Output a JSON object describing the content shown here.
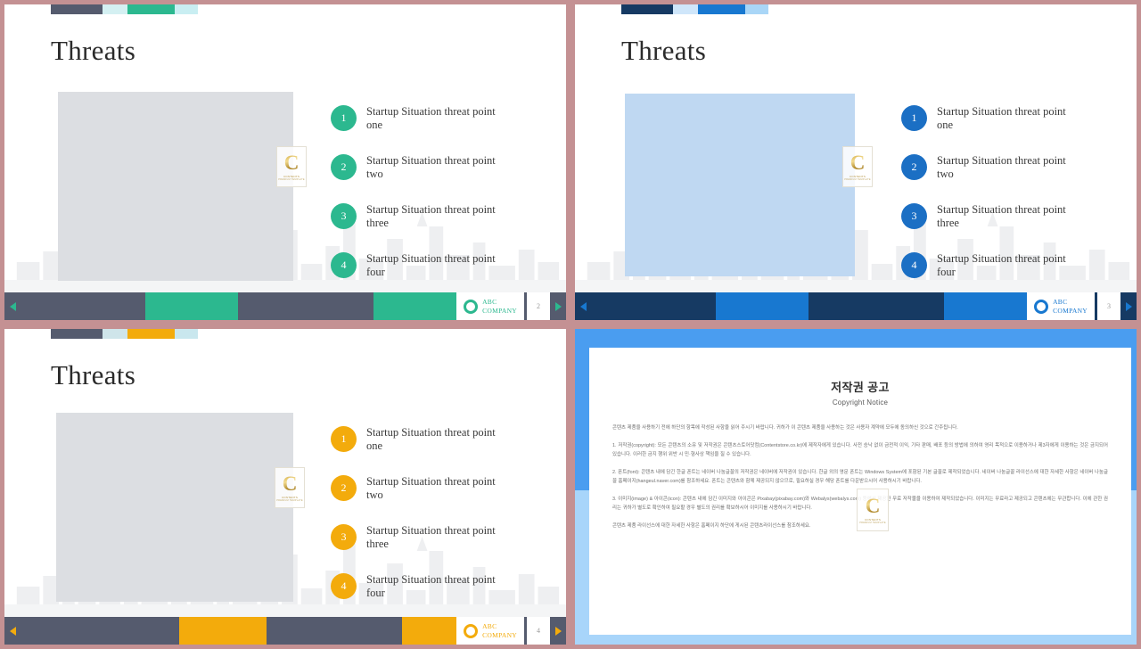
{
  "meta": {
    "outer_border_color": "#c49193",
    "gutter_color": "#c49193"
  },
  "shared": {
    "title": "Threats",
    "points": [
      {
        "num": "1",
        "text": "Startup Situation threat point one"
      },
      {
        "num": "2",
        "text": "Startup Situation threat point two"
      },
      {
        "num": "3",
        "text": "Startup Situation threat point three"
      },
      {
        "num": "4",
        "text": "Startup Situation threat point four"
      }
    ],
    "logo": {
      "line1": "ABC",
      "line2": "COMPANY",
      "ring_icon": "ring-icon",
      "watermark_letter": "C",
      "watermark_sub": "CONTENTS",
      "watermark_sub2": "PREMIUM TEMPLATE"
    },
    "nav": {
      "prev_icon": "triangle-left-icon",
      "next_icon": "triangle-right-icon"
    }
  },
  "slides": [
    {
      "id": "slide-threats-green",
      "theme": "green",
      "title": "Threats",
      "page_number": "2",
      "accent": "#2cb88f",
      "accent_light": "#d4f0f2",
      "dark": "#555b6e",
      "circle_color": "#2cb88f",
      "picture_fill": "#dcdee2",
      "topbar": [
        "#555b6e",
        "#d4f0f2",
        "#2cb88f",
        "#c9eef2"
      ],
      "footer_segments": [
        "#555b6e",
        "#2cb88f",
        "#555b6e",
        "#2cb88f"
      ],
      "logo_color": "#2cb88f",
      "arrow_color": "#2cb88f"
    },
    {
      "id": "slide-threats-blue",
      "theme": "blue",
      "title": "Threats",
      "page_number": "3",
      "accent": "#1878d0",
      "accent_light": "#c6def5",
      "dark": "#163a63",
      "circle_color": "#1b6fc4",
      "picture_fill": "#bfd8f2",
      "topbar": [
        "#163a63",
        "#cfe6fa",
        "#1878d0",
        "#a9d6f7"
      ],
      "footer_segments": [
        "#163a63",
        "#1878d0",
        "#163a63",
        "#1878d0"
      ],
      "logo_color": "#1878d0",
      "arrow_color": "#1878d0"
    },
    {
      "id": "slide-threats-amber",
      "theme": "amber",
      "title": "Threats",
      "page_number": "4",
      "accent": "#f3ab0c",
      "accent_light": "#d4e9ee",
      "dark": "#555b6e",
      "circle_color": "#f3ab0c",
      "picture_fill": "#dcdee2",
      "topbar": [
        "#555b6e",
        "#cfe5ea",
        "#f3ab0c",
        "#c9e7ee"
      ],
      "footer_segments": [
        "#555b6e",
        "#f3ab0c",
        "#555b6e",
        "#f3ab0c"
      ],
      "logo_color": "#f3ab0c",
      "arrow_color": "#f3ab0c"
    }
  ],
  "copyright_slide": {
    "id": "slide-copyright-notice",
    "frame_top_color": "#4a9df0",
    "frame_bottom_color": "#a8d5fa",
    "title_kr": "저작권 공고",
    "title_en": "Copyright Notice",
    "paragraphs": [
      "콘텐츠 제품을 사용하기 전에 하단의 항목에 작성된 사항을 읽어 주시기 바랍니다. 귀하가 이 콘텐츠 제품을 사용하는 것은 사용자 계약에 모두에 동의하신 것으로 간주됩니다.",
      "1. 저작권(copyright): 모든 콘텐츠의 소유 및 저작권은 콘텐츠스토어닷컴(Contentstore.co.kr)에 제작자에게 있습니다. 사전 승낙 없이 금전적 이익, 기타 판매, 배포 등의 방법에 의하여 영리 목적으로 이용하거나 제3자에게 이용하는 것은 금지되어 있습니다. 이러한 금지 행위 위반 시 민·형사상 책임을 질 수 있습니다.",
      "2. 폰트(font): 콘텐츠 내에 담긴 한글 폰트는 네이버 나눔글꼴의 저작권은 네이버에 저작권이 있습니다. 한글 외의 영문 폰트는 Windows System에 포함된 기본 글꼴로 제작되었습니다. 네이버 나눔글꼴 라이선스에 대한 자세한 사항은 네이버 나눔글꼴 홈페이지(hangeul.naver.com)를 참조하세요. 폰트는 콘텐츠와 함께 제공되지 않으므로, 필요하실 경우 해당 폰트를 다운받으시어 사용하시기 바랍니다.",
      "3. 이미지(image) & 아이콘(icon): 콘텐츠 내에 담긴 이미지와 아이콘은 Pixabay(pixabay.com)와 Webalys(webalys.com) 등에서 제공한 무료 저작물을 이용하여 제작되었습니다. 이미지는 무료라고 제공되고 콘텐츠에는 무관합니다. 이에 관한 권리는 귀하가 별도로 확인하여 필요할 경우 별도의 권리를 확보하시어 이미지를 사용하시기 바랍니다.",
      "콘텐츠 제품 라이선스에 대한 자세한 사항은 홈페이지 하단에 게시된 콘텐츠라이선스를 참조하세요."
    ]
  }
}
